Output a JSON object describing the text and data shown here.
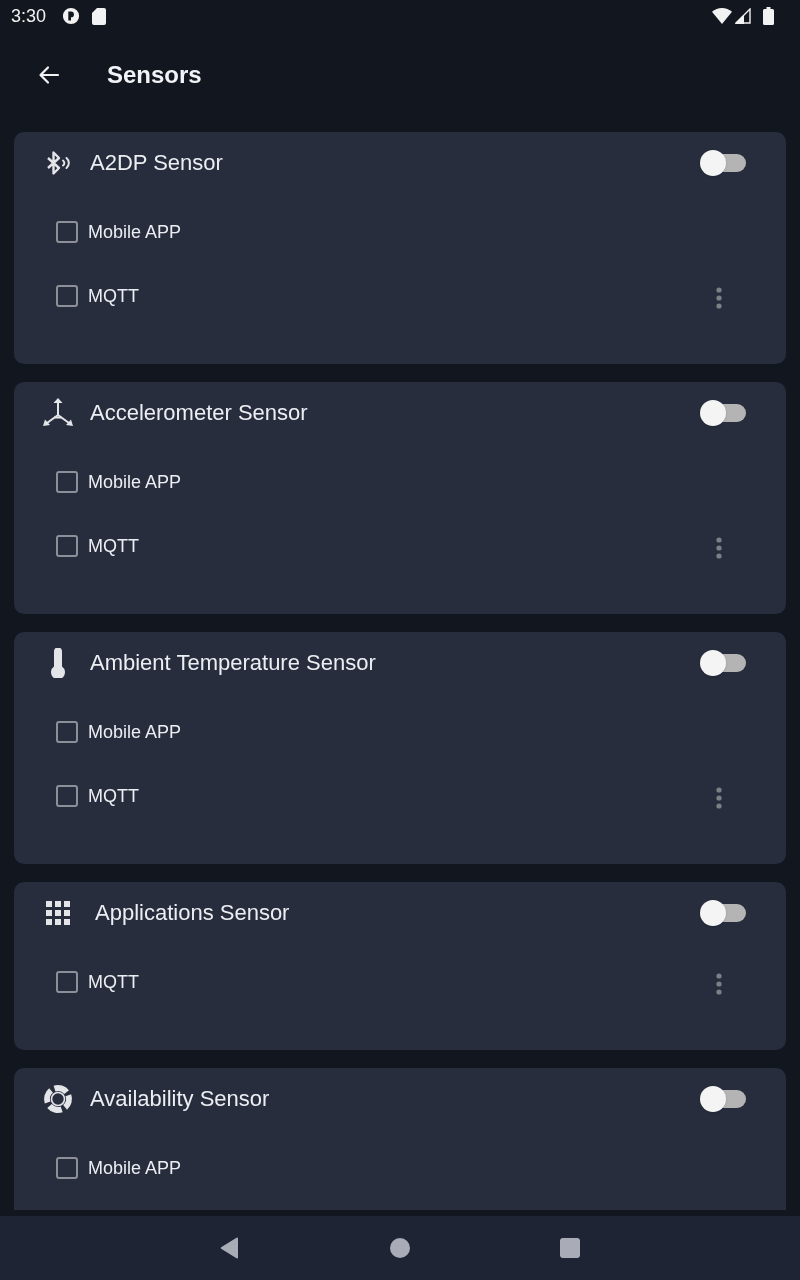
{
  "status_bar": {
    "time": "3:30"
  },
  "app_bar": {
    "title": "Sensors"
  },
  "sensors": [
    {
      "kind": "bluetooth",
      "name": "A2DP Sensor",
      "on": false,
      "targets": [
        {
          "label": "Mobile APP",
          "checked": false,
          "menu": false
        },
        {
          "label": "MQTT",
          "checked": false,
          "menu": true
        }
      ]
    },
    {
      "kind": "accelerometer",
      "name": "Accelerometer Sensor",
      "on": false,
      "targets": [
        {
          "label": "Mobile APP",
          "checked": false,
          "menu": false
        },
        {
          "label": "MQTT",
          "checked": false,
          "menu": true
        }
      ]
    },
    {
      "kind": "thermometer",
      "name": "Ambient Temperature Sensor",
      "on": false,
      "targets": [
        {
          "label": "Mobile APP",
          "checked": false,
          "menu": false
        },
        {
          "label": "MQTT",
          "checked": false,
          "menu": true
        }
      ]
    },
    {
      "kind": "apps",
      "name": "Applications Sensor",
      "on": false,
      "targets": [
        {
          "label": "MQTT",
          "checked": false,
          "menu": true
        }
      ]
    },
    {
      "kind": "availability",
      "name": "Availability Sensor",
      "on": false,
      "targets": [
        {
          "label": "Mobile APP",
          "checked": false,
          "menu": false
        }
      ]
    }
  ]
}
